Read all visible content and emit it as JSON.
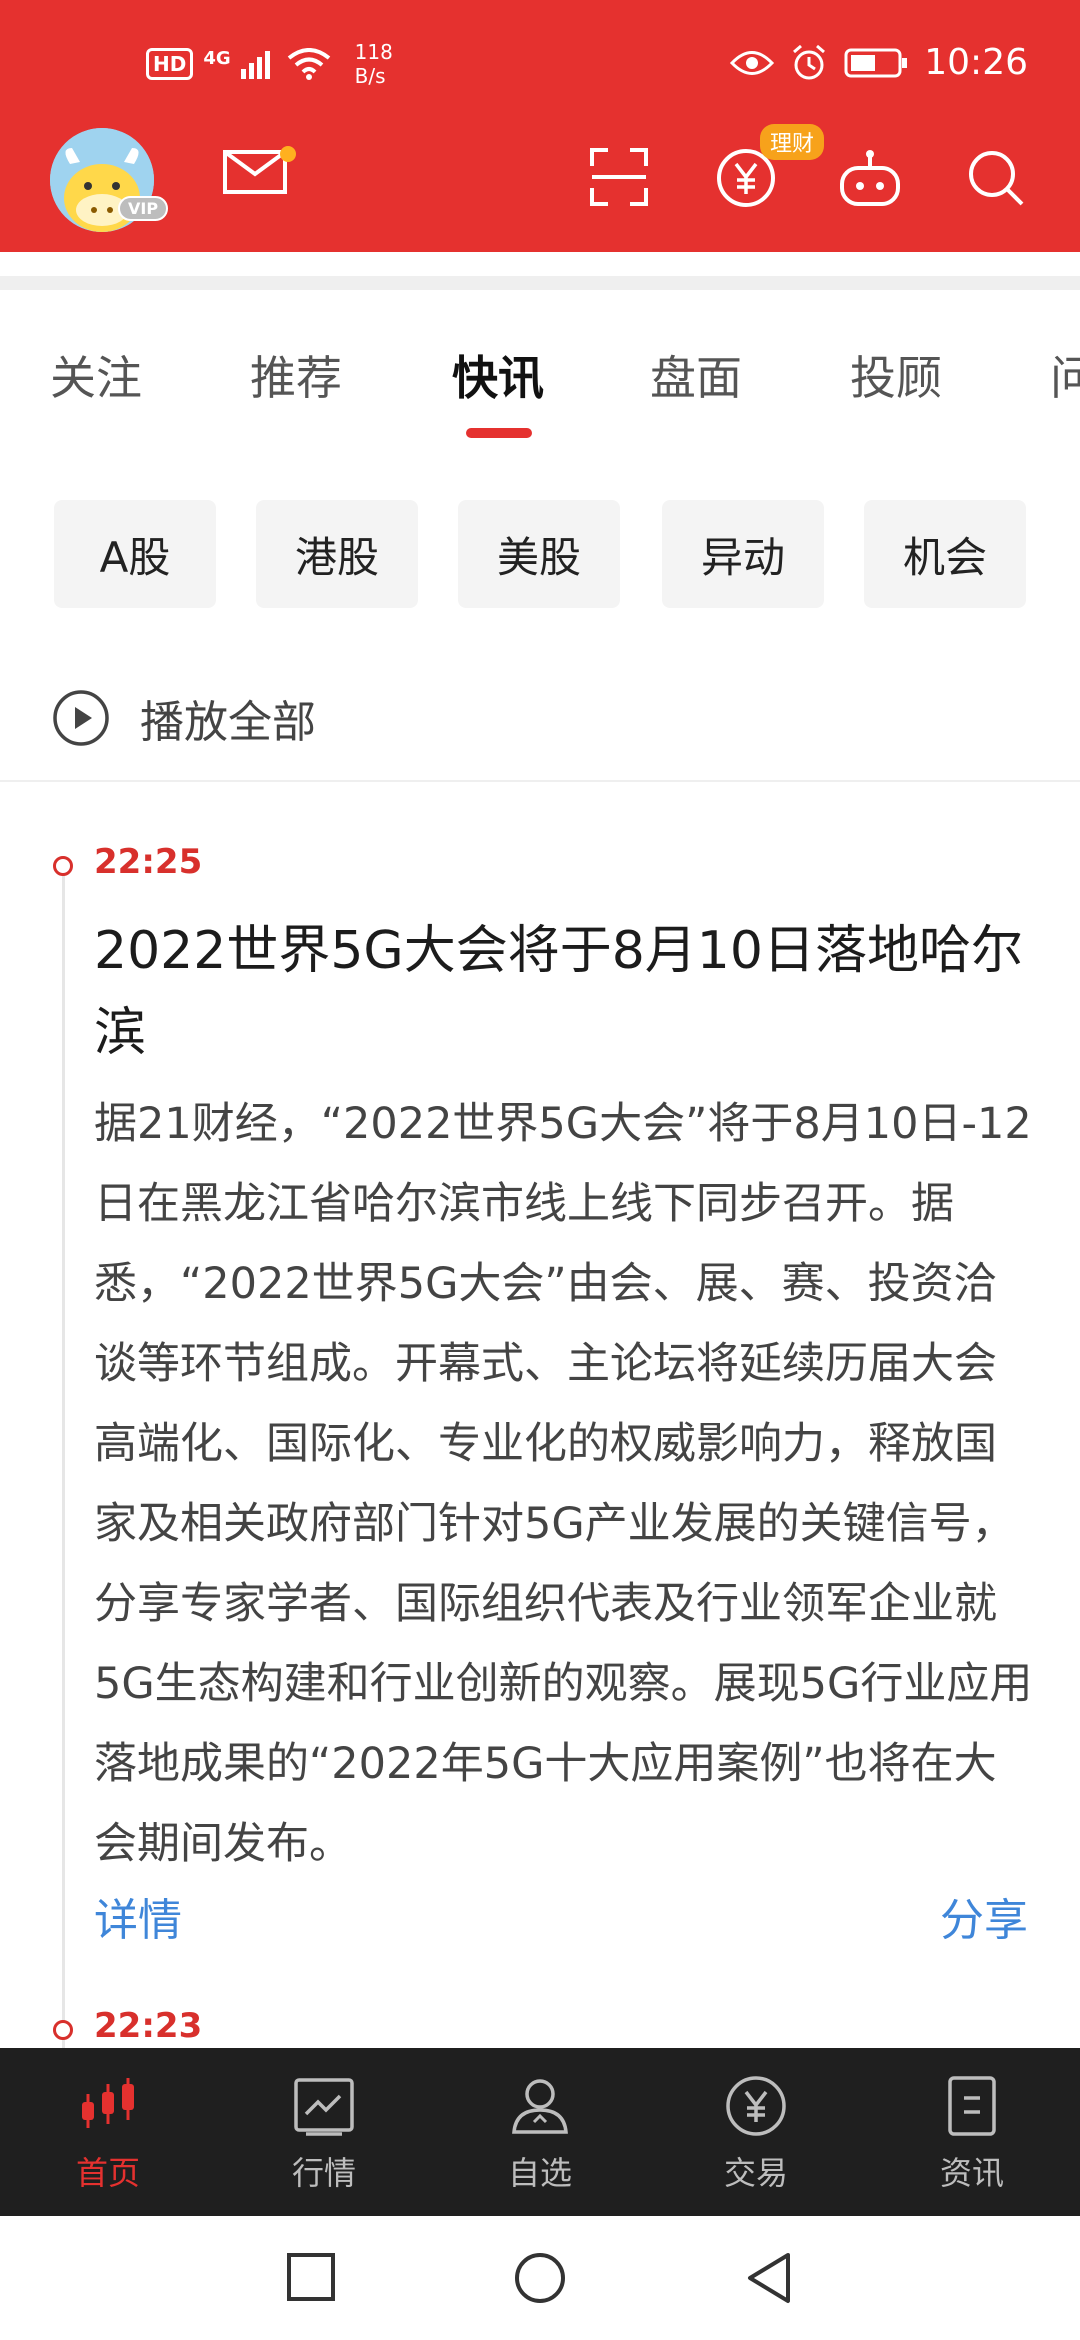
{
  "status_bar": {
    "hd": "HD",
    "network": "4G",
    "speed_value": "118",
    "speed_unit": "B/s",
    "time": "10:26"
  },
  "header": {
    "avatar_badge": "VIP",
    "licai_badge": "理财",
    "icons": [
      "mail-icon",
      "scan-icon",
      "yen-circle-icon",
      "robot-icon",
      "search-icon"
    ],
    "accent_color": "#e5312f"
  },
  "tabs": [
    {
      "label": "关注",
      "active": false
    },
    {
      "label": "推荐",
      "active": false
    },
    {
      "label": "快讯",
      "active": true
    },
    {
      "label": "盘面",
      "active": false
    },
    {
      "label": "投顾",
      "active": false
    },
    {
      "label": "问",
      "active": false
    }
  ],
  "chips": [
    "A股",
    "港股",
    "美股",
    "异动",
    "机会"
  ],
  "play_all": {
    "label": "播放全部"
  },
  "news": [
    {
      "time": "22:25",
      "title": "2022世界5G大会将于8月10日落地哈尔滨",
      "body": "据21财经，“2022世界5G大会”将于8月10日-12日在黑龙江省哈尔滨市线上线下同步召开。据悉，“2022世界5G大会”由会、展、赛、投资洽谈等环节组成。开幕式、主论坛将延续历届大会高端化、国际化、专业化的权威影响力，释放国家及相关政府部门针对5G产业发展的关键信号，分享专家学者、国际组织代表及行业领军企业就5G生态构建和行业创新的观察。展现5G行业应用落地成果的“2022年5G十大应用案例”也将在大会期间发布。",
      "detail_label": "详情",
      "share_label": "分享"
    },
    {
      "time": "22:23"
    }
  ],
  "bottom_nav": [
    {
      "label": "首页",
      "icon": "candlestick-icon",
      "active": true
    },
    {
      "label": "行情",
      "icon": "chart-icon",
      "active": false
    },
    {
      "label": "自选",
      "icon": "user-star-icon",
      "active": false
    },
    {
      "label": "交易",
      "icon": "yen-circle-icon",
      "active": false
    },
    {
      "label": "资讯",
      "icon": "document-icon",
      "active": false
    }
  ],
  "system_nav": [
    "square-icon",
    "circle-icon",
    "triangle-back-icon"
  ]
}
